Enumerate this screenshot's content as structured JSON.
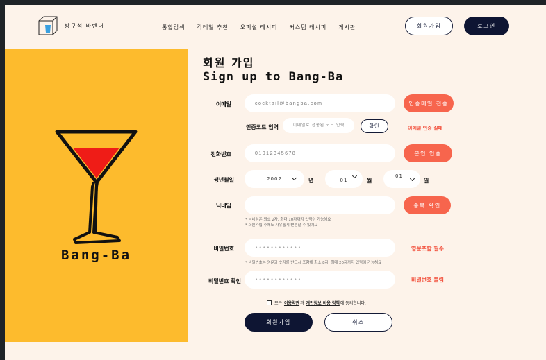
{
  "header": {
    "logo_text": "방구석 바텐더",
    "nav": [
      "통합검색",
      "칵테일 추천",
      "오피셜 레시피",
      "커스텀 레시피",
      "게시판"
    ],
    "signup_label": "회원가입",
    "login_label": "로그인"
  },
  "hero": {
    "brand": "Bang-Ba"
  },
  "form": {
    "title_ko": "회원 가입",
    "title_en": "Sign up to Bang-Ba",
    "email": {
      "label": "이메일",
      "placeholder": "cocktail@bangba.com",
      "button": "인증메일 전송"
    },
    "code": {
      "label": "인증코드 입력",
      "placeholder": "이메일로 전송된 코드 입력",
      "button": "확인",
      "error": "이메일 인증 실패"
    },
    "phone": {
      "label": "전화번호",
      "placeholder": "01012345678",
      "button": "본인 인증"
    },
    "birth": {
      "label": "생년월일",
      "year": "2002",
      "year_unit": "년",
      "month": "01",
      "month_unit": "월",
      "day": "01",
      "day_unit": "일"
    },
    "nickname": {
      "label": "닉네임",
      "button": "중복 확인",
      "hint1": "* 닉네임은 최소 2자, 최대 10자까지 입력이 가능해요",
      "hint2": "* 회원가입 후에도 자유롭게 변경할 수 있어요"
    },
    "password": {
      "label": "비밀번호",
      "value": "••••••••••••",
      "note": "영문포함 필수",
      "hint": "* 비밀번호는 영문과 숫자를 반드시 포함해 최소 8자, 최대 20자까지 입력이 가능해요"
    },
    "password_confirm": {
      "label": "비밀번호 확인",
      "value": "••••••••••••",
      "note": "비밀번호 틀림"
    },
    "agree": {
      "prefix": "모든",
      "terms": "이용약관",
      "mid": "과",
      "privacy": "개인정보 이용 정책",
      "suffix": "에 동의합니다."
    },
    "submit": "회원가입",
    "cancel": "취소"
  },
  "colors": {
    "accent": "#f7654d",
    "navy": "#0e1533",
    "hero_bg": "#fdbb2d",
    "page_bg": "#fdf3ea"
  }
}
